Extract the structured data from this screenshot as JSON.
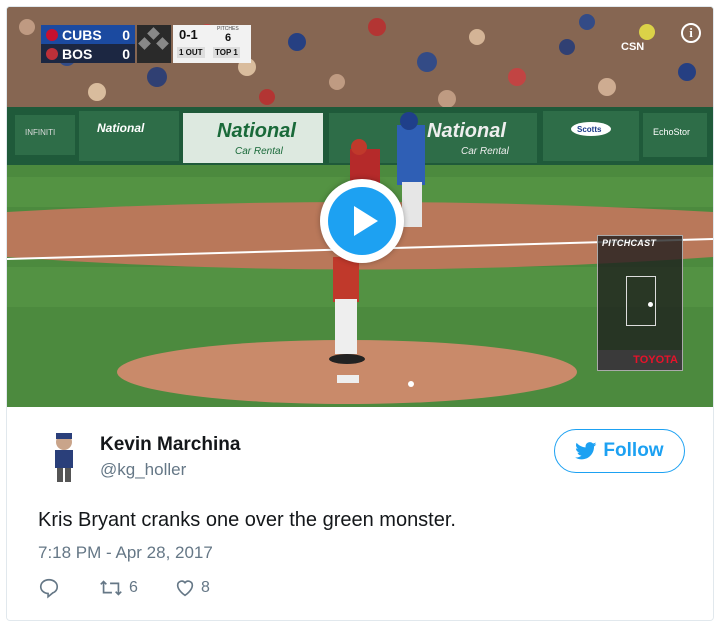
{
  "video": {
    "scorebug": {
      "away_team": "CUBS",
      "away_score": "0",
      "home_team": "BOS",
      "home_score": "0",
      "count": "0-1",
      "pitches_label": "PITCHES",
      "pitches": "6",
      "outs": "1 OUT",
      "inning": "TOP 1"
    },
    "network_logo": "CSN",
    "pitchcast_label": "PITCHCAST",
    "sponsor": "TOYOTA",
    "ads": [
      "INFINITI",
      "National",
      "National",
      "National",
      "Scotts",
      "EchoStor"
    ],
    "ad_sub": "Car Rental",
    "info_icon": "i"
  },
  "tweet": {
    "display_name": "Kevin Marchina",
    "handle": "@kg_holler",
    "follow_label": "Follow",
    "text": "Kris Bryant cranks one over the green monster.",
    "timestamp": "7:18 PM - Apr 28, 2017",
    "retweets": "6",
    "likes": "8"
  },
  "colors": {
    "accent": "#1da1f2",
    "secondary_text": "#657786",
    "border": "#e1e8ed"
  },
  "icons": [
    "play-icon",
    "info-icon",
    "twitter-bird-icon",
    "reply-icon",
    "retweet-icon",
    "heart-icon"
  ]
}
